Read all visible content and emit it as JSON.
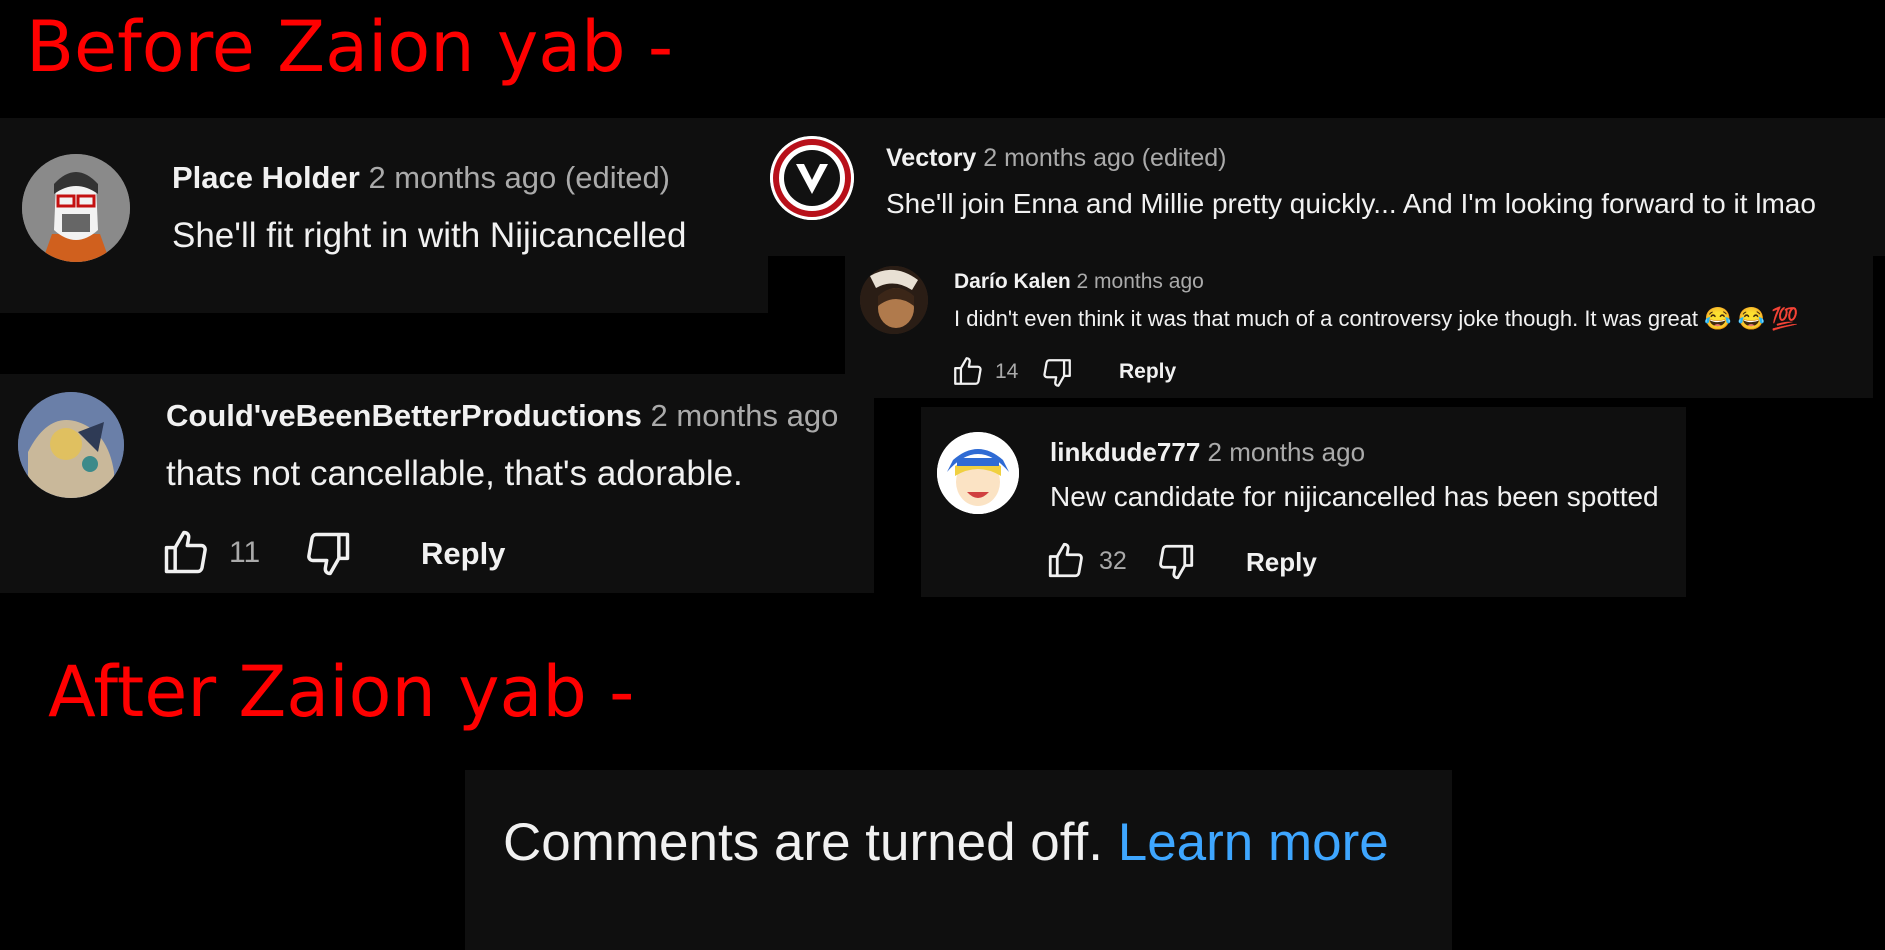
{
  "headings": {
    "before": "Before Zaion yab -",
    "after": "After Zaion yab -"
  },
  "comments": {
    "place_holder": {
      "author": "Place Holder",
      "meta": "2 months ago (edited)",
      "text": "She'll fit right in with Nijicancelled"
    },
    "vectory": {
      "author": "Vectory",
      "meta": "2 months ago (edited)",
      "text": "She'll join Enna and Millie pretty quickly... And I'm looking forward to it lmao"
    },
    "dario": {
      "author": "Darío Kalen",
      "meta": "2 months ago",
      "text": "I didn't even think it was that much of a controversy joke though. It was great 😂 😂 💯",
      "likes": "14",
      "reply": "Reply"
    },
    "couldve": {
      "author": "Could'veBeenBetterProductions",
      "meta": "2 months ago",
      "text": "thats not cancellable, that's adorable.",
      "likes": "11",
      "reply": "Reply"
    },
    "linkdude": {
      "author": "linkdude777",
      "meta": "2 months ago",
      "text": "New candidate for nijicancelled has been spotted",
      "likes": "32",
      "reply": "Reply"
    }
  },
  "comments_off": {
    "text": "Comments are turned off.",
    "link": "Learn more"
  },
  "icons": [
    "like-icon",
    "dislike-icon",
    "avatar"
  ],
  "colors": {
    "heading": "#ff0000",
    "panel": "#0f0f0f",
    "link": "#3ea6ff",
    "meta": "#aaaaaa"
  }
}
